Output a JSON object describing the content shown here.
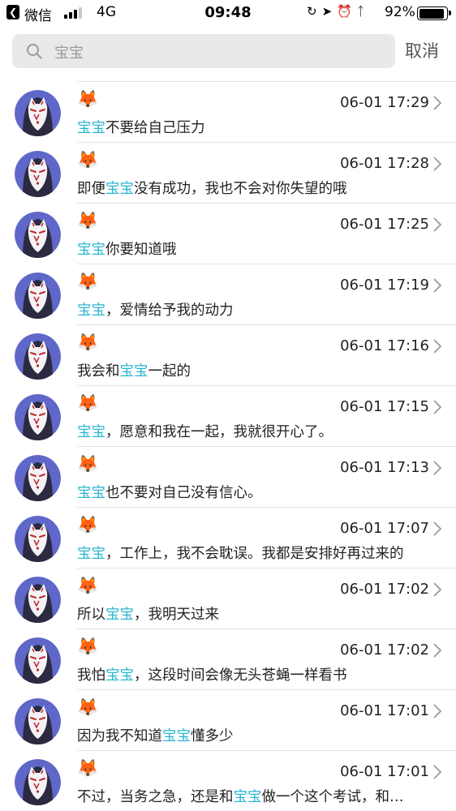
{
  "status_bar": {
    "app": "微信",
    "network": "4G",
    "time": "09:48",
    "battery": "92%",
    "battery_level": 0.92,
    "icons": [
      "screen-rotation-lock-icon",
      "location-icon",
      "alarm-icon",
      "bluetooth-icon"
    ]
  },
  "search": {
    "query": "宝宝",
    "cancel_label": "取消",
    "icon": "search-icon"
  },
  "highlight_color": "#2bb5d0",
  "results": [
    {
      "name": "🦊",
      "time": "06-01 17:29",
      "before": "",
      "hl": "宝宝",
      "after": "不要给自己压力"
    },
    {
      "name": "🦊",
      "time": "06-01 17:28",
      "before": "即便",
      "hl": "宝宝",
      "after": "没有成功，我也不会对你失望的哦"
    },
    {
      "name": "🦊",
      "time": "06-01 17:25",
      "before": "",
      "hl": "宝宝",
      "after": "你要知道哦"
    },
    {
      "name": "🦊",
      "time": "06-01 17:19",
      "before": "",
      "hl": "宝宝",
      "after": "，爱情给予我的动力"
    },
    {
      "name": "🦊",
      "time": "06-01 17:16",
      "before": "我会和",
      "hl": "宝宝",
      "after": "一起的"
    },
    {
      "name": "🦊",
      "time": "06-01 17:15",
      "before": "",
      "hl": "宝宝",
      "after": "，愿意和我在一起，我就很开心了。"
    },
    {
      "name": "🦊",
      "time": "06-01 17:13",
      "before": "",
      "hl": "宝宝",
      "after": "也不要对自己没有信心。"
    },
    {
      "name": "🦊",
      "time": "06-01 17:07",
      "before": "",
      "hl": "宝宝",
      "after": "，工作上，我不会耽误。我都是安排好再过来的"
    },
    {
      "name": "🦊",
      "time": "06-01 17:02",
      "before": "所以",
      "hl": "宝宝",
      "after": "，我明天过来"
    },
    {
      "name": "🦊",
      "time": "06-01 17:02",
      "before": "我怕",
      "hl": "宝宝",
      "after": "，这段时间会像无头苍蝇一样看书"
    },
    {
      "name": "🦊",
      "time": "06-01 17:01",
      "before": "因为我不知道",
      "hl": "宝宝",
      "after": "懂多少"
    },
    {
      "name": "🦊",
      "time": "06-01 17:01",
      "before": "不过，当务之急，还是和",
      "hl": "宝宝",
      "after": "做一个这个考试，和…"
    }
  ]
}
